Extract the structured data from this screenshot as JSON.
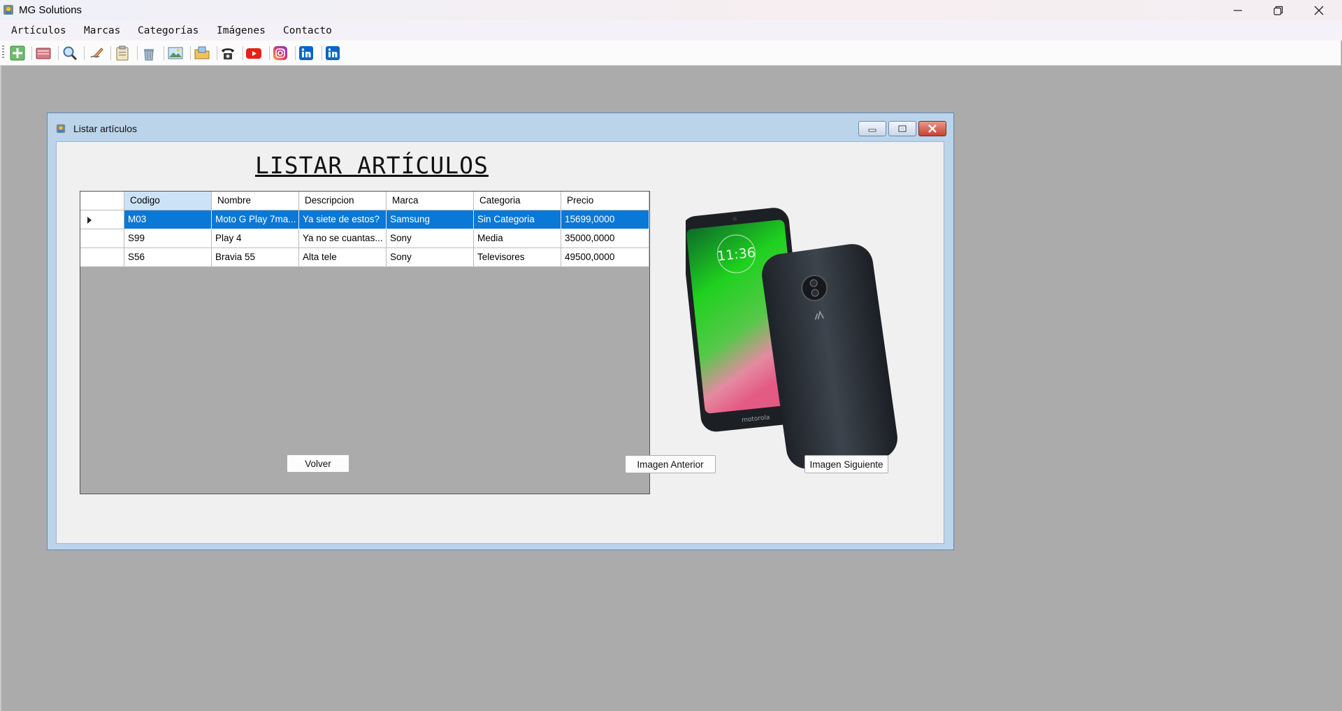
{
  "app": {
    "title": "MG Solutions"
  },
  "menu": [
    "Artículos",
    "Marcas",
    "Categorías",
    "Imágenes",
    "Contacto"
  ],
  "toolbar_icons": [
    "add-icon",
    "card-icon",
    "search-icon",
    "edit-icon",
    "clipboard-icon",
    "trash-icon",
    "image-icon",
    "folder-icon",
    "phone-icon",
    "youtube-icon",
    "instagram-icon",
    "linkedin-icon",
    "linkedin-icon"
  ],
  "child": {
    "title": "Listar artículos",
    "heading": "LISTAR ARTÍCULOS"
  },
  "table": {
    "columns": [
      "Codigo",
      "Nombre",
      "Descripcion",
      "Marca",
      "Categoria",
      "Precio"
    ],
    "rows": [
      [
        "M03",
        "Moto G Play 7ma...",
        "Ya siete de estos?",
        "Samsung",
        "Sin Categoria",
        "15699,0000"
      ],
      [
        "S99",
        "Play 4",
        "Ya no se cuantas...",
        "Sony",
        "Media",
        "35000,0000"
      ],
      [
        "S56",
        "Bravia 55",
        "Alta tele",
        "Sony",
        "Televisores",
        "49500,0000"
      ]
    ],
    "selected_row": 0
  },
  "buttons": {
    "back": "Volver",
    "prev_image": "Imagen Anterior",
    "next_image": "Imagen Siguiente"
  },
  "image_brand_text": "motorola",
  "phone_time": "11:36",
  "colors": {
    "selection": "#0a78d7",
    "youtube": "#e62117",
    "linkedin": "#0a66c2"
  }
}
